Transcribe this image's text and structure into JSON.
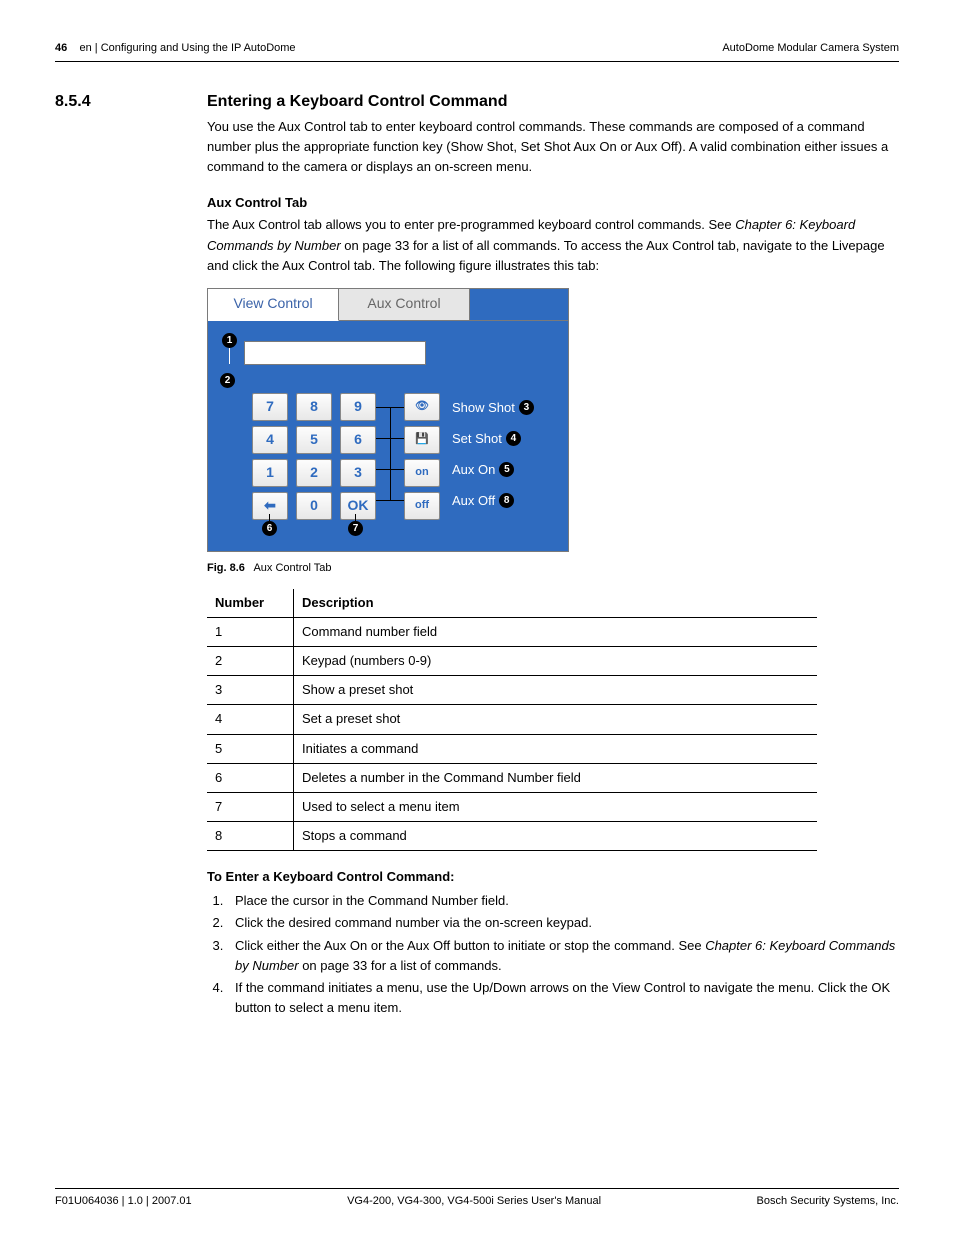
{
  "header": {
    "page_num": "46",
    "left": "en | Configuring and Using the IP AutoDome",
    "right": "AutoDome Modular Camera System"
  },
  "section": {
    "number": "8.5.4",
    "title": "Entering a Keyboard Control Command",
    "intro": "You use the Aux Control tab to enter keyboard control commands. These commands are composed of a command number plus the appropriate function key (Show Shot, Set Shot Aux On or Aux Off). A valid combination either issues a command to the camera or displays an on-screen menu."
  },
  "aux_tab": {
    "heading": "Aux Control Tab",
    "text_a": "The Aux Control tab allows you to enter pre-programmed keyboard control commands. See ",
    "chapter_ref": "Chapter 6: Keyboard Commands by Number",
    "text_b": " on page 33 for a list of all commands. To access the Aux Control tab, navigate to the Livepage and click the Aux Control tab. The following figure illustrates this tab:"
  },
  "figure": {
    "tab_view": "View Control",
    "tab_aux": "Aux Control",
    "keys": {
      "r1": [
        "7",
        "8",
        "9"
      ],
      "r2": [
        "4",
        "5",
        "6"
      ],
      "r3": [
        "1",
        "2",
        "3"
      ],
      "r4_back": "←",
      "r4_zero": "0",
      "r4_ok": "OK"
    },
    "fn": {
      "on": "on",
      "off": "off",
      "show": "Show Shot",
      "set": "Set Shot",
      "auxon": "Aux On",
      "auxoff": "Aux Off"
    },
    "callouts": [
      "1",
      "2",
      "3",
      "4",
      "5",
      "6",
      "7",
      "8"
    ],
    "caption_label": "Fig. 8.6",
    "caption_text": "Aux Control Tab"
  },
  "table": {
    "h1": "Number",
    "h2": "Description",
    "rows": [
      {
        "n": "1",
        "d": "Command number field"
      },
      {
        "n": "2",
        "d": "Keypad (numbers 0-9)"
      },
      {
        "n": "3",
        "d": "Show a preset shot"
      },
      {
        "n": "4",
        "d": "Set a preset shot"
      },
      {
        "n": "5",
        "d": "Initiates a command"
      },
      {
        "n": "6",
        "d": "Deletes a number in the Command Number field"
      },
      {
        "n": "7",
        "d": "Used to select a menu item"
      },
      {
        "n": "8",
        "d": "Stops a command"
      }
    ]
  },
  "procedure": {
    "heading": "To Enter a Keyboard Control Command:",
    "s1": "Place the cursor in the Command Number field.",
    "s2": "Click the desired command number via the on-screen keypad.",
    "s3a": "Click either the Aux On or the Aux Off button to initiate or stop the command. See ",
    "s3ref": "Chapter 6: Keyboard Commands by Number",
    "s3b": " on page 33 for a list of commands.",
    "s4": "If the command initiates a menu, use the Up/Down arrows on the View Control to navigate the menu. Click the OK button to select a menu item."
  },
  "footer": {
    "left": "F01U064036 | 1.0 | 2007.01",
    "center": "VG4-200, VG4-300, VG4-500i Series User's Manual",
    "right": "Bosch Security Systems, Inc."
  }
}
